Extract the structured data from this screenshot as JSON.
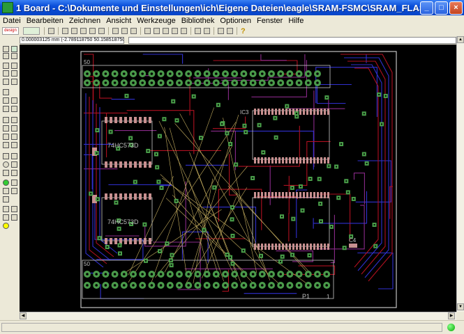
{
  "window": {
    "title": "1 Board - C:\\Dokumente und Einstellungen\\ich\\Eigene Dateien\\eagle\\SRAM-FSMC\\SRAM_FLAS..."
  },
  "menu": [
    "Datei",
    "Bearbeiten",
    "Zeichnen",
    "Ansicht",
    "Werkzeuge",
    "Bibliothek",
    "Optionen",
    "Fenster",
    "Hilfe"
  ],
  "toolbar": {
    "logo_left": "design link",
    "help_glyph": "?"
  },
  "coordinates": {
    "readout": "0.000003125 mm (-2.789118750 50.158518750)"
  },
  "board": {
    "labels": {
      "header_top": "50",
      "header_bottom_left": "50",
      "ic_upper_left": "74HC573D",
      "ic_lower_left": "74HC573D",
      "ic_upper_right": "IC3",
      "connector_name": "P1",
      "connector_pin1": "1",
      "c4": "C4"
    }
  }
}
